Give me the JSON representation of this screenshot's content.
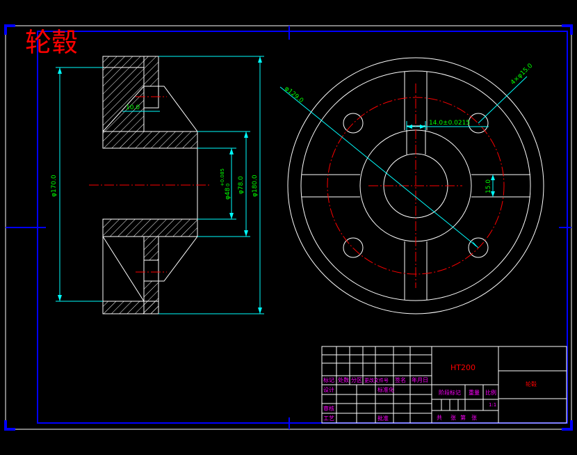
{
  "title": "轮毂",
  "dimensions": {
    "d170": "φ170.0",
    "d48": "φ48",
    "d48_tol_upper": "+0.085",
    "d48_tol_lower": "0",
    "d78": "φ78.0",
    "d180": "φ180.0",
    "d10": "10.0",
    "d129": "φ129.0",
    "holes": "4×φ15.0",
    "keyway": "14.0±0.0215",
    "d15": "15.0"
  },
  "title_block": {
    "material": "HT200",
    "part_name": "轮毂",
    "scale": "1:1",
    "labels": {
      "mark": "标记",
      "count": "处数",
      "zone": "分区",
      "change_doc": "更改文件号",
      "sign": "签名",
      "date": "年月日",
      "design": "设计",
      "standardize": "标准化",
      "stage_mark": "阶段标记",
      "weight": "重量",
      "scale": "比例",
      "review": "审核",
      "process": "工艺",
      "approve": "批准",
      "total": "共",
      "sheets": "张",
      "sheet_no": "第",
      "sheet_unit": "张"
    }
  },
  "colors": {
    "line": "#ffffff",
    "dimension": "#00ffff",
    "dim_text": "#00ff00",
    "center": "#ff0000",
    "frame": "#0000ff",
    "title": "#ff0000",
    "tb_text": "#ff00ff"
  }
}
